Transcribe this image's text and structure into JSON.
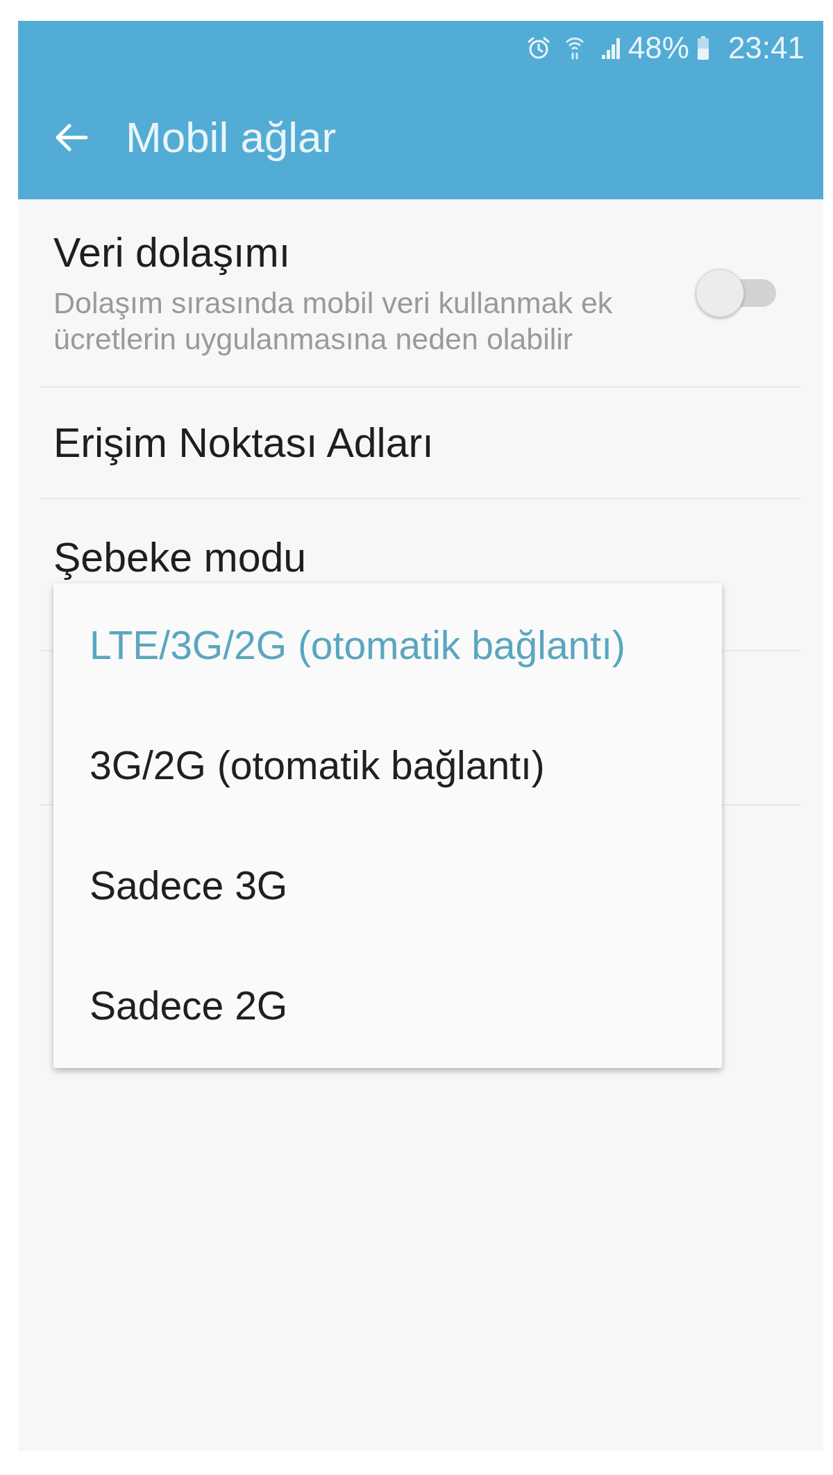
{
  "status_bar": {
    "battery": "48%",
    "time": "23:41"
  },
  "app_bar": {
    "title": "Mobil ağlar"
  },
  "settings": [
    {
      "kind": "toggle",
      "title": "Veri dolaşımı",
      "summary": "Dolaşım sırasında mobil veri kullanmak ek ücretlerin uygulanmasına neden olabilir",
      "on": false
    },
    {
      "kind": "plain",
      "title": "Erişim Noktası Adları"
    },
    {
      "kind": "plain",
      "title": "Şebeke modu"
    }
  ],
  "network_mode_menu": {
    "options": [
      {
        "label": "LTE/3G/2G (otomatik bağlantı)",
        "selected": true
      },
      {
        "label": "3G/2G (otomatik bağlantı)",
        "selected": false
      },
      {
        "label": "Sadece 3G",
        "selected": false
      },
      {
        "label": "Sadece 2G",
        "selected": false
      }
    ]
  }
}
